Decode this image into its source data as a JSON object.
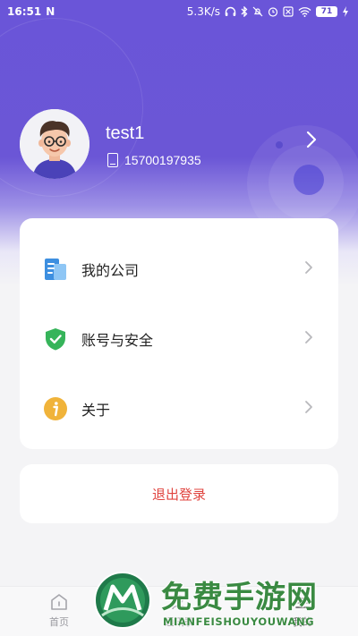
{
  "status_bar": {
    "time": "16:51",
    "app_badge": "N",
    "network_speed": "5.3K/s",
    "battery_level": "71",
    "icons": [
      "headphones-icon",
      "bluetooth-icon",
      "mute-icon",
      "alarm-icon",
      "sim-off-icon",
      "wifi-icon",
      "battery-icon",
      "charging-icon"
    ]
  },
  "profile": {
    "username": "test1",
    "phone": "15700197935"
  },
  "menu": {
    "items": [
      {
        "label": "我的公司",
        "icon": "company-document-icon"
      },
      {
        "label": "账号与安全",
        "icon": "shield-check-icon"
      },
      {
        "label": "关于",
        "icon": "info-icon"
      }
    ]
  },
  "logout": {
    "label": "退出登录"
  },
  "tabbar": {
    "tabs": [
      {
        "label": "首页",
        "icon": "home-icon"
      },
      {
        "label": "通讯录",
        "icon": "contacts-icon"
      },
      {
        "label": "我的",
        "icon": "profile-icon"
      }
    ]
  },
  "watermark": {
    "title": "免费手游网",
    "subtitle": "MIANFEISHOUYOUWANG"
  },
  "colors": {
    "header_purple": "#6a55d8",
    "logout_red": "#e0443f",
    "watermark_green": "#3a8a42"
  }
}
